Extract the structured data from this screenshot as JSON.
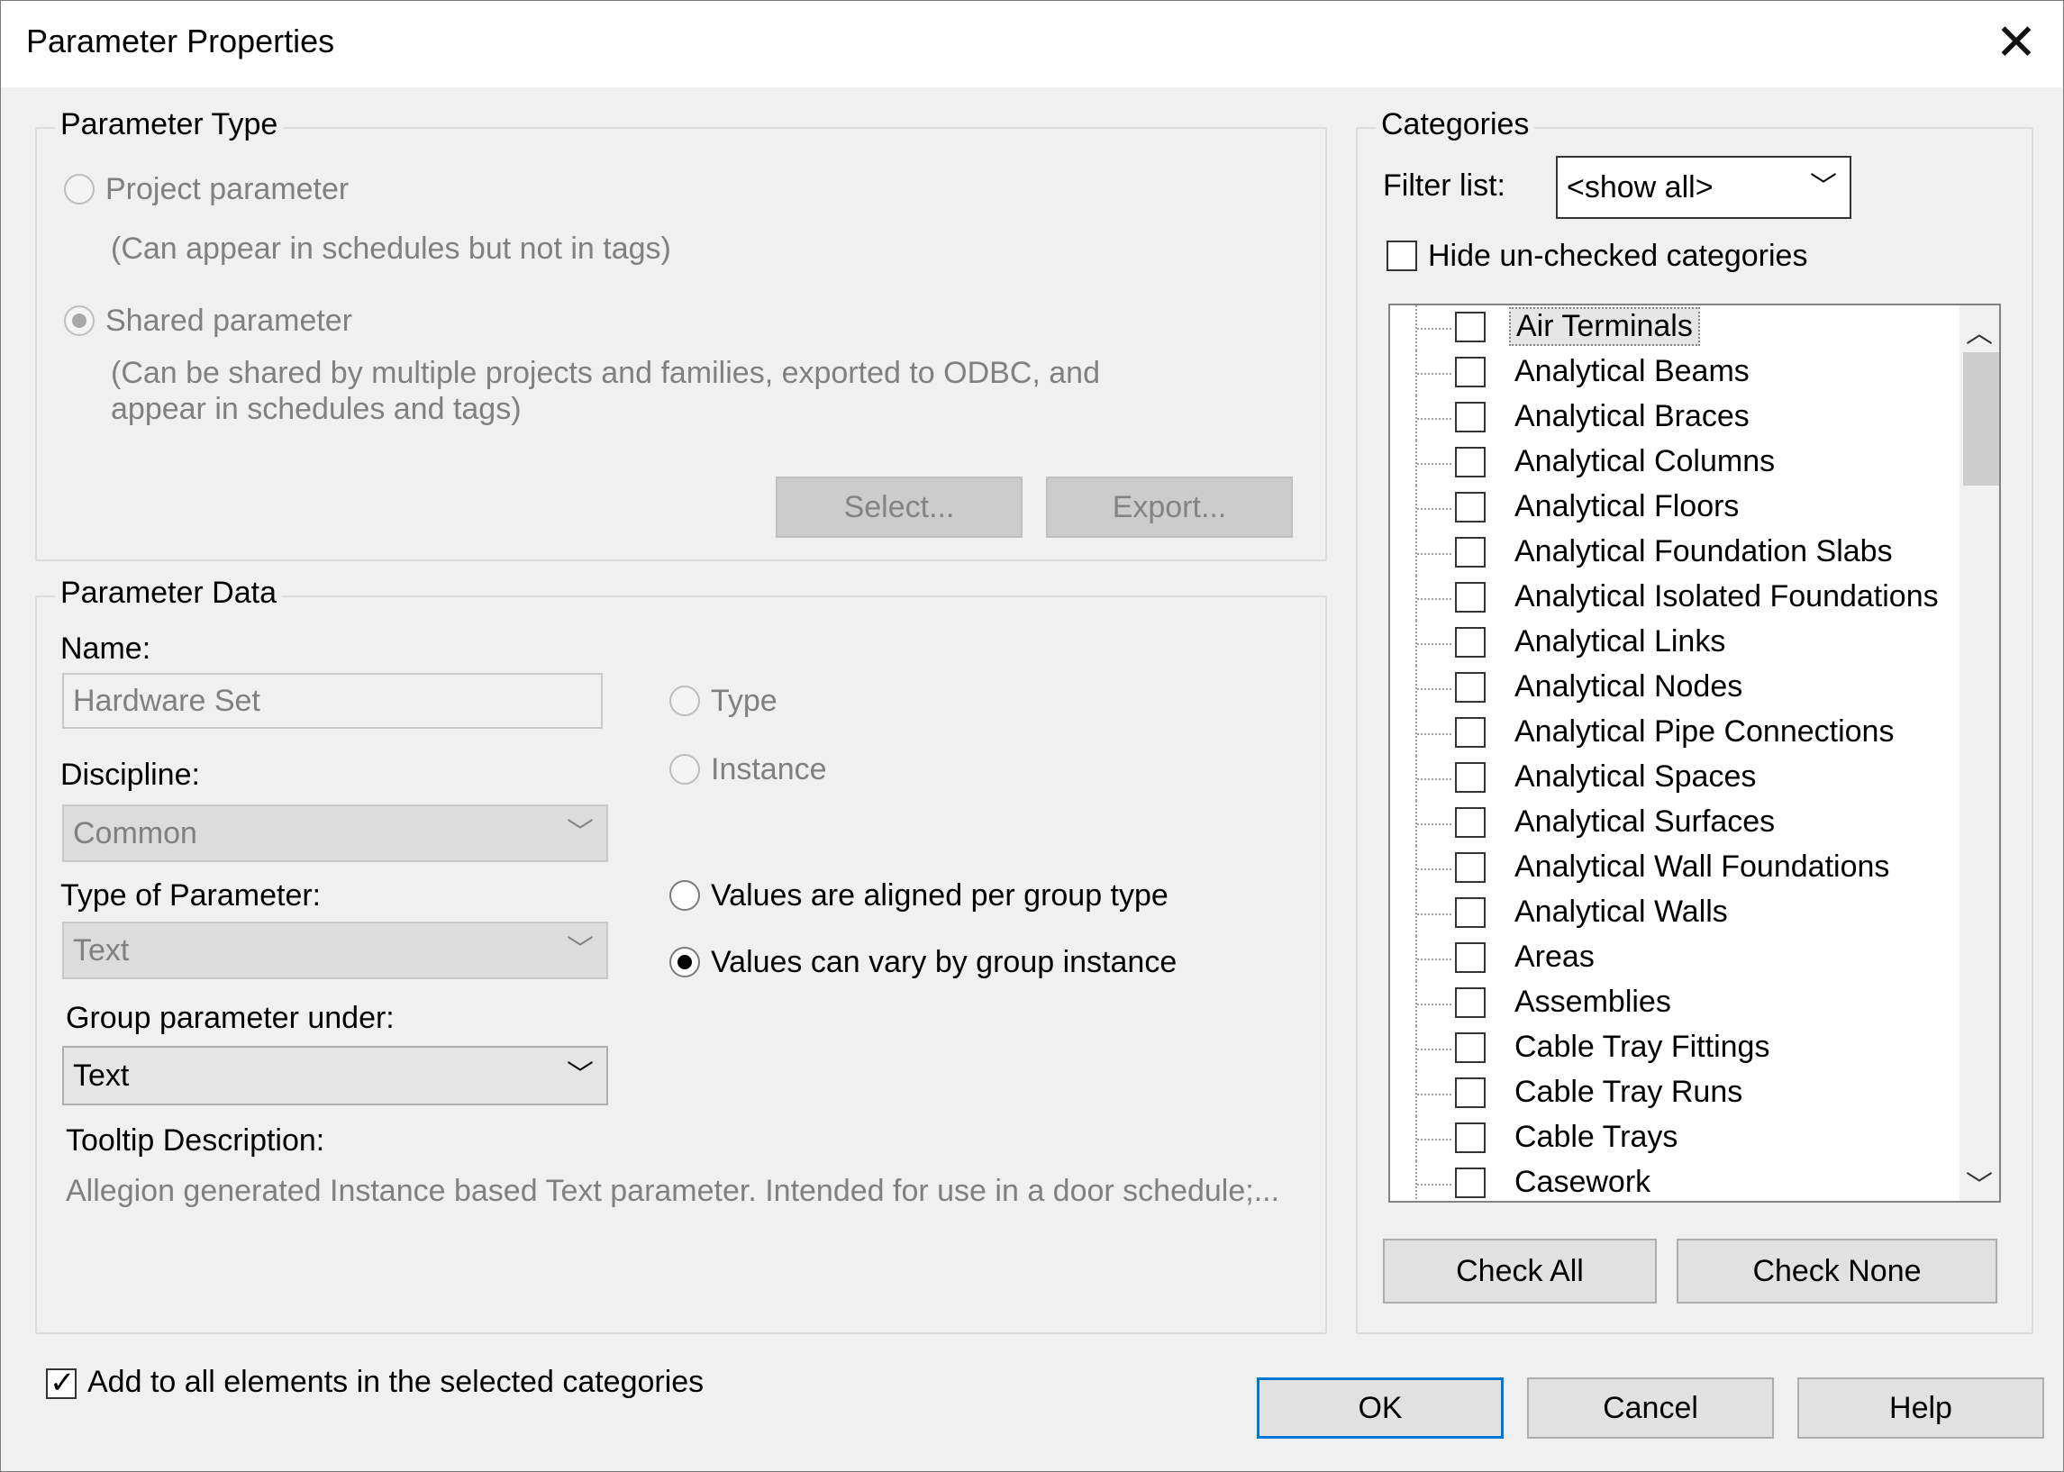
{
  "window": {
    "title": "Parameter Properties",
    "close_glyph": "✕"
  },
  "parameter_type": {
    "legend": "Parameter Type",
    "project_label": "Project parameter",
    "project_desc": "(Can appear in schedules but not in tags)",
    "shared_label": "Shared parameter",
    "shared_desc_1": "(Can be shared by multiple projects and families, exported to ODBC, and",
    "shared_desc_2": "appear in schedules and tags)",
    "select_button": "Select...",
    "export_button": "Export..."
  },
  "parameter_data": {
    "legend": "Parameter Data",
    "name_label": "Name:",
    "name_value": "Hardware Set",
    "type_radio": "Type",
    "instance_radio": "Instance",
    "discipline_label": "Discipline:",
    "discipline_value": "Common",
    "type_of_parameter_label": "Type of Parameter:",
    "type_of_parameter_value": "Text",
    "aligned_radio": "Values are aligned per group type",
    "vary_radio": "Values can vary by group instance",
    "group_under_label": "Group parameter under:",
    "group_under_value": "Text",
    "tooltip_label": "Tooltip Description:",
    "tooltip_value": "Allegion generated Instance based Text parameter.  Intended for use in a door schedule;..."
  },
  "categories": {
    "legend": "Categories",
    "filter_label": "Filter list:",
    "filter_value": "<show all>",
    "hide_unchecked_label": "Hide un-checked categories",
    "items": [
      "Air Terminals",
      "Analytical Beams",
      "Analytical Braces",
      "Analytical Columns",
      "Analytical Floors",
      "Analytical Foundation Slabs",
      "Analytical Isolated Foundations",
      "Analytical Links",
      "Analytical Nodes",
      "Analytical Pipe Connections",
      "Analytical Spaces",
      "Analytical Surfaces",
      "Analytical Wall Foundations",
      "Analytical Walls",
      "Areas",
      "Assemblies",
      "Cable Tray Fittings",
      "Cable Tray Runs",
      "Cable Trays",
      "Casework"
    ],
    "check_all_button": "Check All",
    "check_none_button": "Check None"
  },
  "footer": {
    "add_to_all_label": "Add to all elements in the selected categories",
    "ok_button": "OK",
    "cancel_button": "Cancel",
    "help_button": "Help"
  }
}
